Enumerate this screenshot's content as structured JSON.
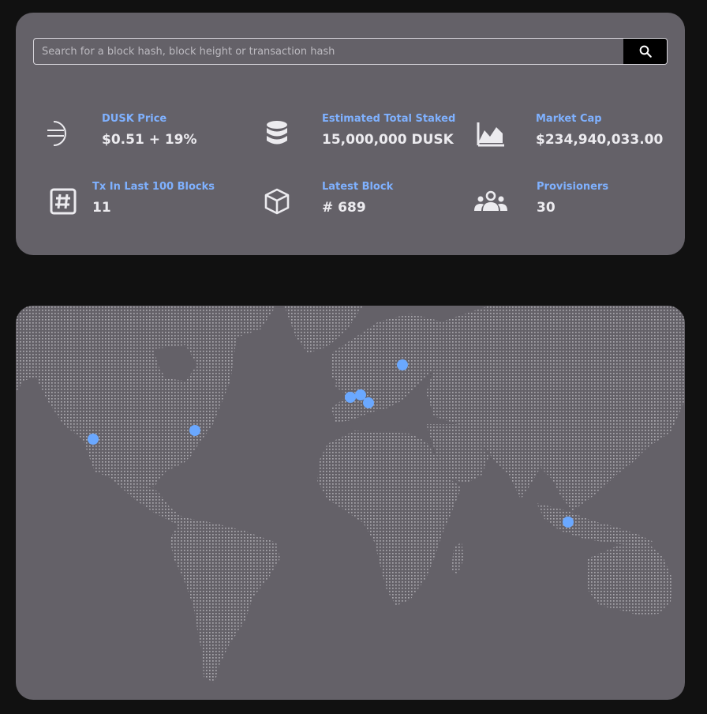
{
  "search": {
    "placeholder": "Search for a block hash, block height or transaction hash"
  },
  "stats": [
    {
      "label": "DUSK Price",
      "value": "$0.51 + 19%",
      "icon": "dusk-logo-icon"
    },
    {
      "label": "Estimated Total Staked",
      "value": "15,000,000 DUSK",
      "icon": "database-icon"
    },
    {
      "label": "Market Cap",
      "value": "$234,940,033.00",
      "icon": "chart-icon"
    },
    {
      "label": "Tx In Last 100 Blocks",
      "value": "11",
      "icon": "hash-icon"
    },
    {
      "label": "Latest Block",
      "value": "# 689",
      "icon": "cube-icon"
    },
    {
      "label": "Provisioners",
      "value": "30",
      "icon": "group-icon"
    }
  ],
  "colors": {
    "page_bg": "#111111",
    "card_bg": "#646168",
    "label": "#7fb1ff",
    "marker": "#6aa8ff",
    "map_dots": "#a9a7ad"
  }
}
